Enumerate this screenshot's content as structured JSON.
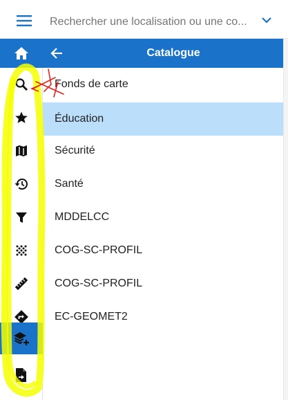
{
  "search": {
    "placeholder": "Rechercher une localisation ou une co..."
  },
  "panel": {
    "title": "Catalogue"
  },
  "catalog": {
    "items": [
      {
        "label": "Fonds de carte",
        "selected": false
      },
      {
        "label": "Éducation",
        "selected": true
      },
      {
        "label": "Sécurité",
        "selected": false
      },
      {
        "label": "Santé",
        "selected": false
      },
      {
        "label": "MDDELCC",
        "selected": false
      },
      {
        "label": "COG-SC-PROFIL",
        "selected": false
      },
      {
        "label": "COG-SC-PROFIL",
        "selected": false
      },
      {
        "label": "EC-GEOMET2",
        "selected": false
      }
    ]
  },
  "rail": {
    "icons": [
      "home-icon",
      "search-icon",
      "star-icon",
      "map-icon",
      "history-icon",
      "filter-icon",
      "dots-grid-icon",
      "ruler-icon",
      "directions-icon",
      "layers-add-icon",
      "file-export-icon"
    ],
    "active": "layers-add-icon"
  },
  "colors": {
    "primary": "#1a73c9",
    "selected_row": "#bbdefb",
    "annotation_yellow": "#f5ff00",
    "annotation_red": "#e8221b"
  }
}
